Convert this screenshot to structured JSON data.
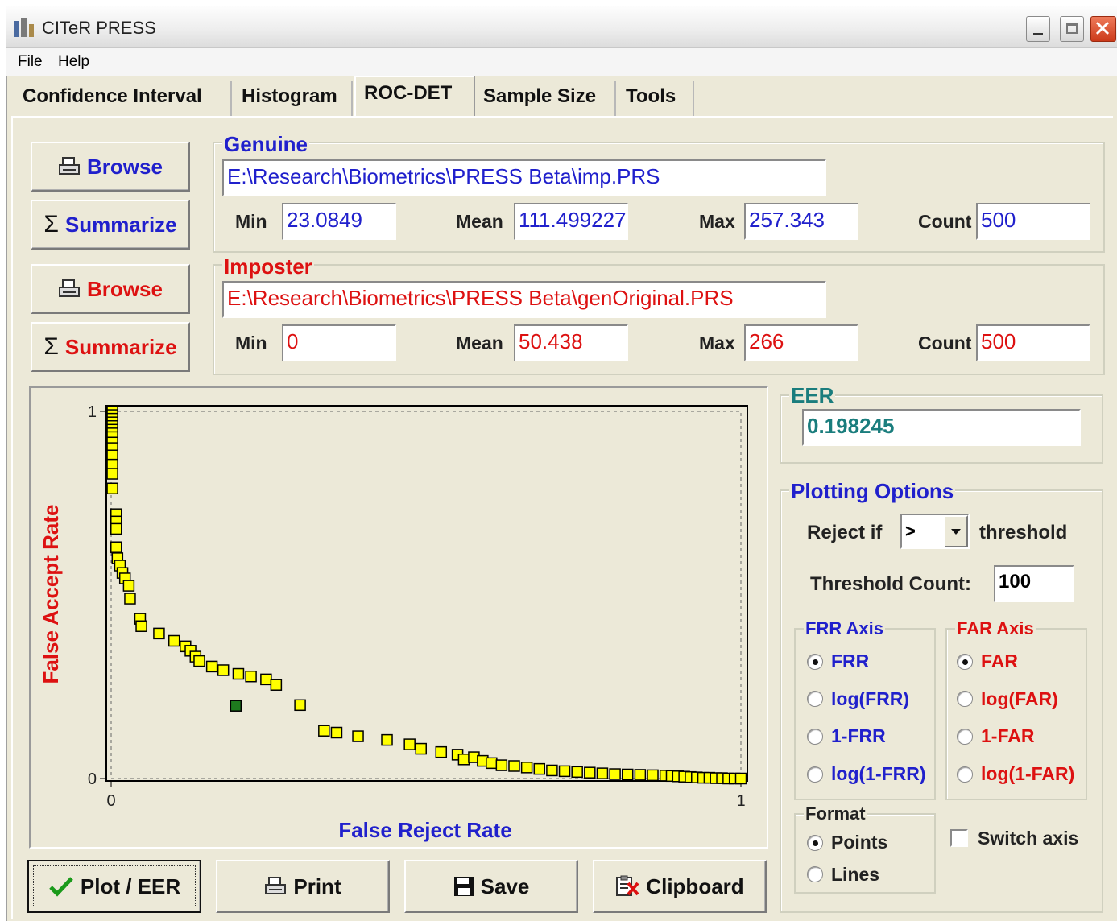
{
  "window": {
    "title": "CITeR PRESS"
  },
  "menu": {
    "items": [
      "File",
      "Help"
    ]
  },
  "tabs": [
    "Confidence Interval",
    "Histogram",
    "ROC-DET",
    "Sample Size",
    "Tools"
  ],
  "active_tab": "ROC-DET",
  "buttons": {
    "browse": "Browse",
    "summarize": "Summarize",
    "plot_eer": "Plot / EER",
    "print": "Print",
    "save": "Save",
    "clipboard": "Clipboard"
  },
  "genuine": {
    "label": "Genuine",
    "path": "E:\\Research\\Biometrics\\PRESS Beta\\imp.PRS",
    "min_label": "Min",
    "min": "23.0849",
    "mean_label": "Mean",
    "mean": "111.499227",
    "max_label": "Max",
    "max": "257.343",
    "count_label": "Count",
    "count": "500"
  },
  "imposter": {
    "label": "Imposter",
    "path": "E:\\Research\\Biometrics\\PRESS Beta\\genOriginal.PRS",
    "min_label": "Min",
    "min": "0",
    "mean_label": "Mean",
    "mean": "50.438",
    "max_label": "Max",
    "max": "266",
    "count_label": "Count",
    "count": "500"
  },
  "eer": {
    "label": "EER",
    "value": "0.198245"
  },
  "plotting_options": {
    "label": "Plotting Options",
    "reject_if_label": "Reject if",
    "reject_if_value": ">",
    "threshold_label": "threshold",
    "threshold_count_label": "Threshold Count:",
    "threshold_count": "100",
    "frr_axis": {
      "label": "FRR Axis",
      "options": [
        "FRR",
        "log(FRR)",
        "1-FRR",
        "log(1-FRR)"
      ],
      "selected": "FRR"
    },
    "far_axis": {
      "label": "FAR Axis",
      "options": [
        "FAR",
        "log(FAR)",
        "1-FAR",
        "log(1-FAR)"
      ],
      "selected": "FAR"
    },
    "format": {
      "label": "Format",
      "options": [
        "Points",
        "Lines"
      ],
      "selected": "Points"
    },
    "switch_axis_label": "Switch axis",
    "switch_axis": false
  },
  "colors": {
    "genuine": "#2020cc",
    "imposter": "#dd1111",
    "eer": "#1a7d7d",
    "marker": "#ffff00",
    "eer_marker": "#1e7a1e",
    "background": "#ece9d8"
  },
  "chart_data": {
    "type": "scatter",
    "xlabel": "False Reject Rate",
    "ylabel": "False Accept Rate",
    "xlim": [
      0,
      1
    ],
    "ylim": [
      0,
      1
    ],
    "x_ticks": [
      "0",
      "1"
    ],
    "y_ticks": [
      "0",
      "1"
    ],
    "grid": false,
    "marker": "square",
    "points": [
      [
        0.002,
        1.0
      ],
      [
        0.002,
        0.99
      ],
      [
        0.002,
        0.98
      ],
      [
        0.002,
        0.97
      ],
      [
        0.002,
        0.96
      ],
      [
        0.002,
        0.95
      ],
      [
        0.002,
        0.94
      ],
      [
        0.002,
        0.93
      ],
      [
        0.002,
        0.915
      ],
      [
        0.002,
        0.9
      ],
      [
        0.002,
        0.88
      ],
      [
        0.002,
        0.855
      ],
      [
        0.002,
        0.83
      ],
      [
        0.002,
        0.79
      ],
      [
        0.008,
        0.72
      ],
      [
        0.008,
        0.7
      ],
      [
        0.008,
        0.68
      ],
      [
        0.008,
        0.63
      ],
      [
        0.01,
        0.6
      ],
      [
        0.014,
        0.58
      ],
      [
        0.018,
        0.56
      ],
      [
        0.022,
        0.545
      ],
      [
        0.028,
        0.525
      ],
      [
        0.03,
        0.49
      ],
      [
        0.046,
        0.435
      ],
      [
        0.048,
        0.415
      ],
      [
        0.076,
        0.395
      ],
      [
        0.1,
        0.375
      ],
      [
        0.118,
        0.36
      ],
      [
        0.126,
        0.348
      ],
      [
        0.134,
        0.332
      ],
      [
        0.14,
        0.32
      ],
      [
        0.16,
        0.305
      ],
      [
        0.178,
        0.295
      ],
      [
        0.202,
        0.285
      ],
      [
        0.222,
        0.278
      ],
      [
        0.246,
        0.27
      ],
      [
        0.262,
        0.255
      ],
      [
        0.3,
        0.2
      ],
      [
        0.338,
        0.13
      ],
      [
        0.358,
        0.125
      ],
      [
        0.392,
        0.115
      ],
      [
        0.438,
        0.105
      ],
      [
        0.474,
        0.093
      ],
      [
        0.492,
        0.081
      ],
      [
        0.524,
        0.072
      ],
      [
        0.55,
        0.065
      ],
      [
        0.56,
        0.052
      ],
      [
        0.576,
        0.058
      ],
      [
        0.59,
        0.048
      ],
      [
        0.604,
        0.042
      ],
      [
        0.62,
        0.036
      ],
      [
        0.64,
        0.034
      ],
      [
        0.66,
        0.03
      ],
      [
        0.68,
        0.026
      ],
      [
        0.7,
        0.022
      ],
      [
        0.72,
        0.02
      ],
      [
        0.74,
        0.018
      ],
      [
        0.76,
        0.016
      ],
      [
        0.78,
        0.014
      ],
      [
        0.8,
        0.012
      ],
      [
        0.82,
        0.011
      ],
      [
        0.84,
        0.01
      ],
      [
        0.86,
        0.009
      ],
      [
        0.88,
        0.008
      ],
      [
        0.89,
        0.007
      ],
      [
        0.9,
        0.006
      ],
      [
        0.91,
        0.005
      ],
      [
        0.92,
        0.004
      ],
      [
        0.93,
        0.003
      ],
      [
        0.94,
        0.002
      ],
      [
        0.95,
        0.002
      ],
      [
        0.96,
        0.001
      ],
      [
        0.97,
        0.001
      ],
      [
        0.98,
        0.0
      ],
      [
        0.99,
        0.0
      ],
      [
        1.0,
        0.0
      ]
    ],
    "eer_point": [
      0.198,
      0.198
    ]
  }
}
